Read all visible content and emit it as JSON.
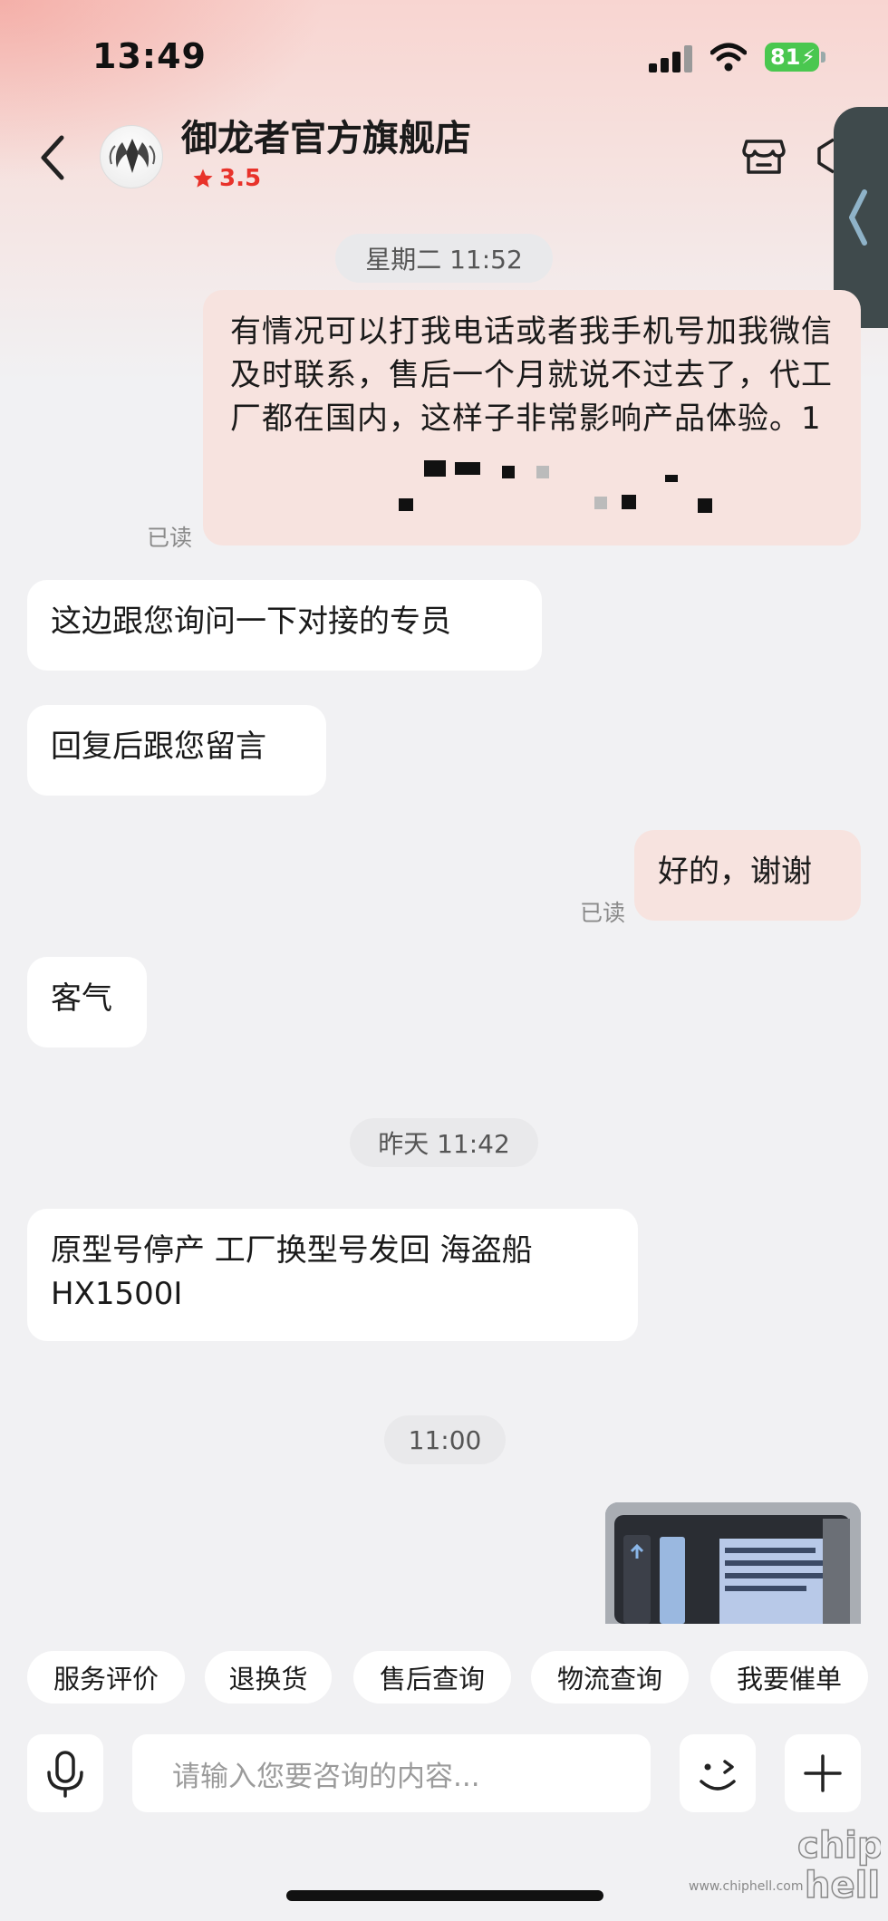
{
  "status_bar": {
    "time": "13:49",
    "battery": "81"
  },
  "header": {
    "store_name": "御龙者官方旗舰店",
    "rating": "3.5",
    "back_icon": "chevron-left-icon",
    "store_icon": "store-icon"
  },
  "messages": [
    {
      "type": "time",
      "text": "星期二 11:52"
    },
    {
      "type": "out",
      "text": "有情况可以打我电话或者我手机号加我微信及时联系，售后一个月就说不过去了，代工厂都在国内，这样子非常影响产品体验。1",
      "read": "已读"
    },
    {
      "type": "in",
      "text": "这边跟您询问一下对接的专员"
    },
    {
      "type": "in",
      "text": "回复后跟您留言"
    },
    {
      "type": "out",
      "text": "好的，谢谢",
      "read": "已读"
    },
    {
      "type": "in",
      "text": "客气"
    },
    {
      "type": "time",
      "text": "昨天 11:42"
    },
    {
      "type": "in",
      "text": "原型号停产 工厂换型号发回 海盗船 HX1500I"
    },
    {
      "type": "time",
      "text": "11:00"
    },
    {
      "type": "out-image"
    }
  ],
  "quick_actions": [
    "服务评价",
    "退换货",
    "售后查询",
    "物流查询",
    "我要催单"
  ],
  "composer": {
    "placeholder": "请输入您要咨询的内容...",
    "mic_icon": "microphone-icon",
    "emoji_icon": "wink-face-icon",
    "plus_icon": "plus-icon"
  },
  "watermark": "www.chiphell.com",
  "colors": {
    "rating_red": "#e8322a",
    "out_bubble": "#f7e3df",
    "in_bubble": "#ffffff",
    "battery_green": "#4ac74f"
  }
}
